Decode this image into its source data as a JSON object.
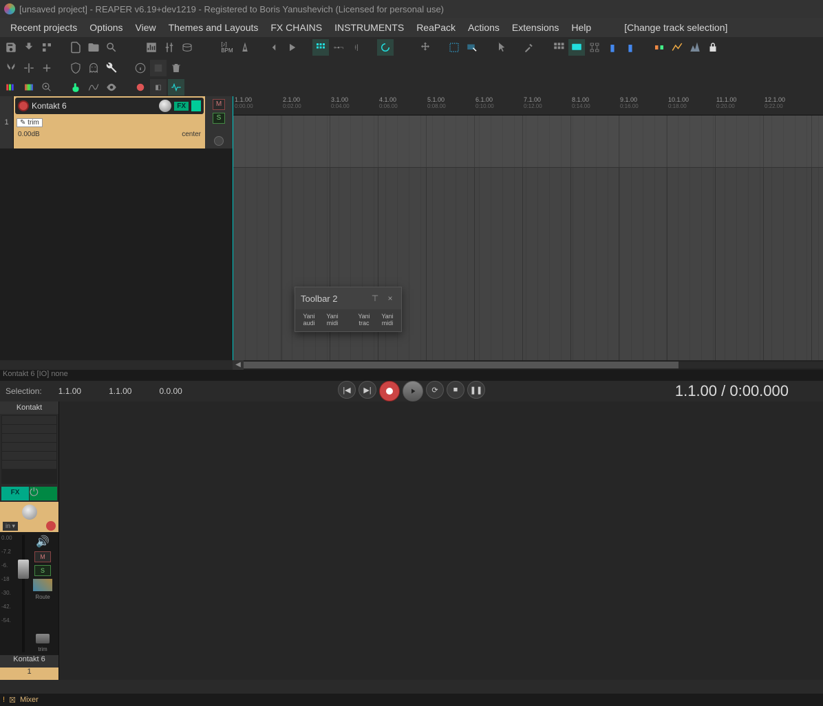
{
  "title": "[unsaved project] - REAPER v6.19+dev1219 - Registered to Boris Yanushevich (Licensed for personal use)",
  "menu": [
    "Recent projects",
    "Options",
    "View",
    "Themes and Layouts",
    "FX CHAINS",
    "INSTRUMENTS",
    "ReaPack",
    "Actions",
    "Extensions",
    "Help"
  ],
  "menu_extra": "[Change track selection]",
  "ruler": [
    {
      "bar": "1.1.00",
      "time": "0:00.00"
    },
    {
      "bar": "2.1.00",
      "time": "0:02.00"
    },
    {
      "bar": "3.1.00",
      "time": "0:04.00"
    },
    {
      "bar": "4.1.00",
      "time": "0:06.00"
    },
    {
      "bar": "5.1.00",
      "time": "0:08.00"
    },
    {
      "bar": "6.1.00",
      "time": "0:10.00"
    },
    {
      "bar": "7.1.00",
      "time": "0:12.00"
    },
    {
      "bar": "8.1.00",
      "time": "0:14.00"
    },
    {
      "bar": "9.1.00",
      "time": "0:16.00"
    },
    {
      "bar": "10.1.00",
      "time": "0:18.00"
    },
    {
      "bar": "11.1.00",
      "time": "0:20.00"
    },
    {
      "bar": "12.1.00",
      "time": "0:22.00"
    }
  ],
  "track": {
    "num": "1",
    "name": "Kontakt 6",
    "fx": "FX",
    "trim": "trim",
    "vol": "0.00dB",
    "pan": "center",
    "m": "M",
    "s": "S"
  },
  "status_io": "Kontakt 6 [IO] none",
  "selection": {
    "label": "Selection:",
    "start": "1.1.00",
    "end": "1.1.00",
    "len": "0.0.00"
  },
  "time_display": "1.1.00 / 0:00.000",
  "floating": {
    "title": "Toolbar 2",
    "items": [
      [
        "Yani",
        "audi"
      ],
      [
        "Yani",
        "midi"
      ],
      [
        "Yani",
        "trac"
      ],
      [
        "Yani",
        "midi"
      ]
    ]
  },
  "mixer": {
    "name_top": "Kontakt",
    "fx": "FX",
    "in": "in",
    "scale": [
      "0.00",
      "-7.2",
      "-6.",
      "-18",
      "-30.",
      "-42.",
      "-54."
    ],
    "m": "M",
    "s": "S",
    "route": "Route",
    "trim": "trim",
    "name_bottom": "Kontakt 6",
    "num": "1"
  },
  "bottom": {
    "warn": "!",
    "mixer": "Mixer"
  }
}
